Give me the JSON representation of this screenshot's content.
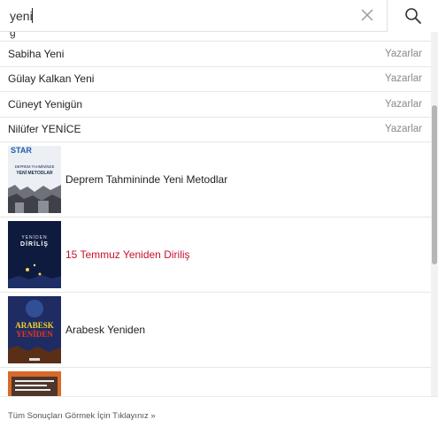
{
  "search": {
    "value": "yeni",
    "clear_icon": "close-icon",
    "submit_icon": "search-icon"
  },
  "authors": [
    {
      "name": "Sabiha Yeni",
      "category": "Yazarlar"
    },
    {
      "name": "Gülay Kalkan Yeni",
      "category": "Yazarlar"
    },
    {
      "name": "Cüneyt Yenigün",
      "category": "Yazarlar"
    },
    {
      "name": "Nilüfer YENİCE",
      "category": "Yazarlar"
    }
  ],
  "books": [
    {
      "title": "Deprem Tahmininde Yeni Metodlar",
      "cover_text": {
        "top": "STAR",
        "line1": "DEPREM TAHMİNİNDE",
        "line2": "YENİ METODLAR"
      },
      "highlighted": false
    },
    {
      "title": "15 Temmuz Yeniden Diriliş",
      "cover_text": {
        "line1": "YENİDEN",
        "line2": "DİRİLİŞ"
      },
      "highlighted": true
    },
    {
      "title": "Arabesk Yeniden",
      "cover_text": {
        "line1": "ARABESK",
        "line2": "YENİDEN"
      },
      "highlighted": false
    }
  ],
  "colors": {
    "highlight": "#c8102e",
    "category_text": "#8a8a8a"
  },
  "footer": {
    "link": "Tüm Sonuçları Görmek İçin Tıklayınız »"
  }
}
